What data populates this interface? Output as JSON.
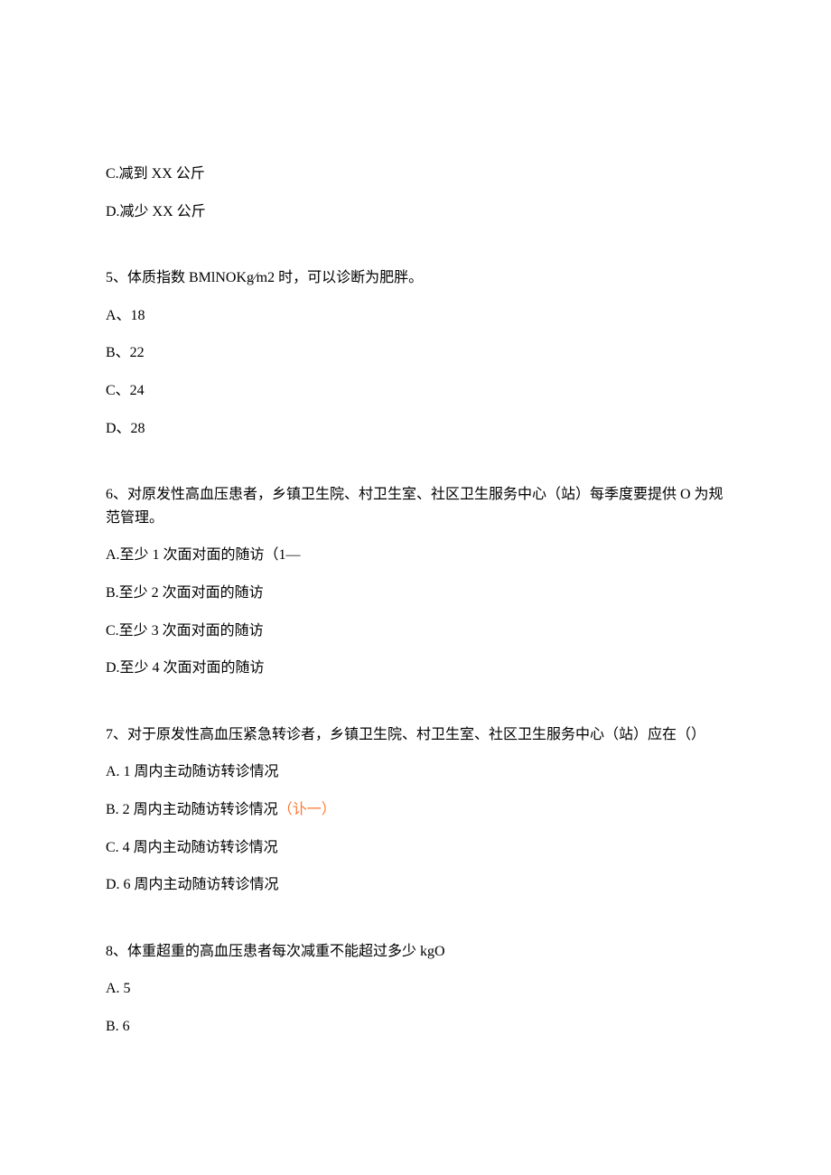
{
  "block4_tail": {
    "options": [
      "C.减到 XX 公斤",
      "D.减少 XX 公斤"
    ]
  },
  "q5": {
    "stem": "5、体质指数 BMlNOKg⁄m2 时，可以诊断为肥胖。",
    "options": [
      "A、18",
      "B、22",
      "C、24",
      "D、28"
    ]
  },
  "q6": {
    "stem": "6、对原发性高血压患者，乡镇卫生院、村卫生室、社区卫生服务中心（站）每季度要提供 O 为规范管理。",
    "options": [
      "A.至少 1 次面对面的随访（1—",
      "B.至少 2 次面对面的随访",
      "C.至少 3 次面对面的随访",
      "D.至少 4 次面对面的随访"
    ]
  },
  "q7": {
    "stem": "7、对于原发性高血压紧急转诊者，乡镇卫生院、村卫生室、社区卫生服务中心（站）应在（）",
    "options": [
      "A.   1 周内主动随访转诊情况",
      "B.   2 周内主动随访转诊情况",
      "C.   4 周内主动随访转诊情况",
      "D.   6 周内主动随访转诊情况"
    ],
    "annotation_b": "（讣一）"
  },
  "q8": {
    "stem": "8、体重超重的高血压患者每次减重不能超过多少 kgO",
    "options": [
      "A.   5",
      "B.   6"
    ]
  }
}
